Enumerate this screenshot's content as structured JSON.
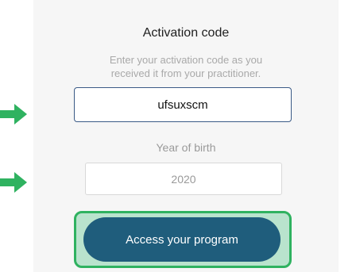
{
  "form": {
    "title": "Activation code",
    "subtitle_line1": "Enter your activation code as you",
    "subtitle_line2": "received it from your practitioner.",
    "activation_code_value": "ufsuxscm",
    "year_label": "Year of birth",
    "year_value": "2020",
    "submit_label": "Access your program"
  },
  "annotations": {
    "arrow_color": "#2fb260",
    "highlight_fill": "#b9e3cd",
    "highlight_border": "#2fb260",
    "icons": [
      "right-arrow-icon",
      "right-arrow-icon"
    ]
  },
  "colors": {
    "button": "#1f5d7c",
    "field_border_active": "#3a5a86",
    "panel": "#f6f6f6"
  }
}
